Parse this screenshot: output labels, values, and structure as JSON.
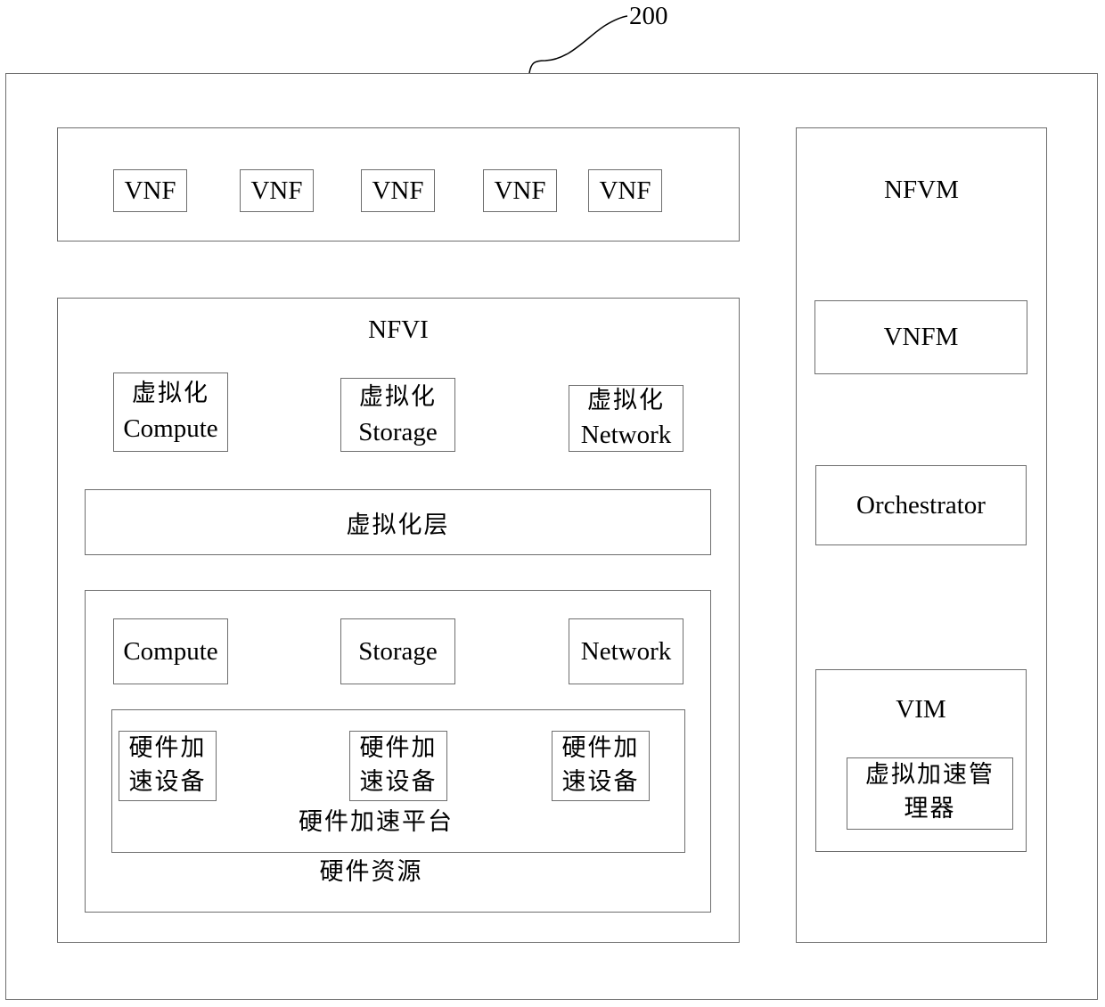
{
  "reference": {
    "label": "200"
  },
  "system": {
    "vnf_group": {
      "items": [
        "VNF",
        "VNF",
        "VNF",
        "VNF",
        "VNF"
      ]
    },
    "nfvi": {
      "title": "NFVI",
      "virtual_resources": [
        {
          "line1": "虚拟化",
          "line2": "Compute"
        },
        {
          "line1": "虚拟化",
          "line2": "Storage"
        },
        {
          "line1": "虚拟化",
          "line2": "Network"
        }
      ],
      "virtualization_layer": "虚拟化层",
      "hardware_resources": {
        "title": "硬件资源",
        "items": [
          "Compute",
          "Storage",
          "Network"
        ],
        "acceleration_platform": {
          "title": "硬件加速平台",
          "devices": [
            {
              "line1": "硬件加",
              "line2": "速设备"
            },
            {
              "line1": "硬件加",
              "line2": "速设备"
            },
            {
              "line1": "硬件加",
              "line2": "速设备"
            }
          ]
        }
      }
    },
    "nfvm": {
      "title": "NFVM",
      "vnfm": "VNFM",
      "orchestrator": "Orchestrator",
      "vim": {
        "title": "VIM",
        "manager": {
          "line1": "虚拟加速管",
          "line2": "理器"
        }
      }
    }
  }
}
